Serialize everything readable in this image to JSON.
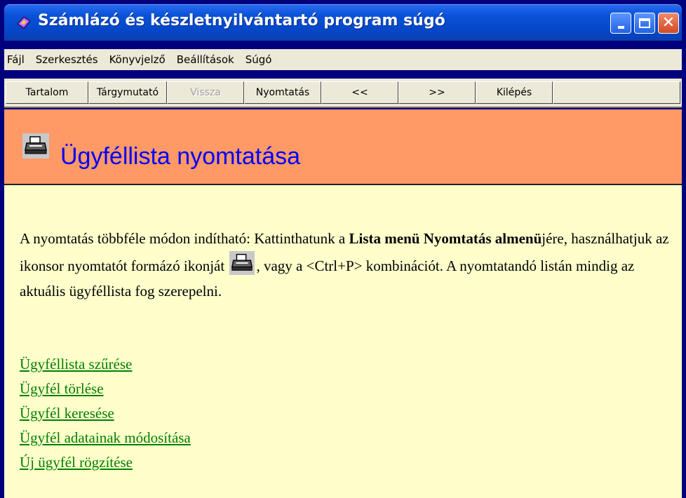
{
  "window": {
    "title": "Számlázó és készletnyilvántartó program súgó",
    "icon": "help-book-icon"
  },
  "menu": [
    "Fájl",
    "Szerkesztés",
    "Könyvjelző",
    "Beállítások",
    "Súgó"
  ],
  "toolbar": {
    "tartalom": "Tartalom",
    "targymutato": "Tárgymutató",
    "vissza": "Vissza",
    "nyomtatas": "Nyomtatás",
    "prev": "<<",
    "next": ">>",
    "kilepes": "Kilépés"
  },
  "page": {
    "heading": "Ügyféllista nyomtatása",
    "heading_icon": "printer-icon",
    "para_a": "A nyomtatás többféle módon indítható: Kattinthatunk a ",
    "para_bold": "Lista menü Nyomtatás almenü",
    "para_b": "jére, használhatjuk az ikonsor nyomtatót formázó ikonját ",
    "para_c": ", vagy a <Ctrl+P> kombinációt. A nyomtatandó listán mindig az aktuális ügyféllista fog szerepelni.",
    "links": [
      "Ügyféllista szűrése",
      "Ügyfél törlése",
      "Ügyfél keresése",
      "Ügyfél adatainak módosítása",
      "Új ügyfél rögzítése"
    ]
  },
  "colors": {
    "title_bar": "#0a52d8",
    "header_bg": "#ff9966",
    "heading_text": "#0000ff",
    "content_bg": "#ffffcc",
    "link": "#008000"
  }
}
